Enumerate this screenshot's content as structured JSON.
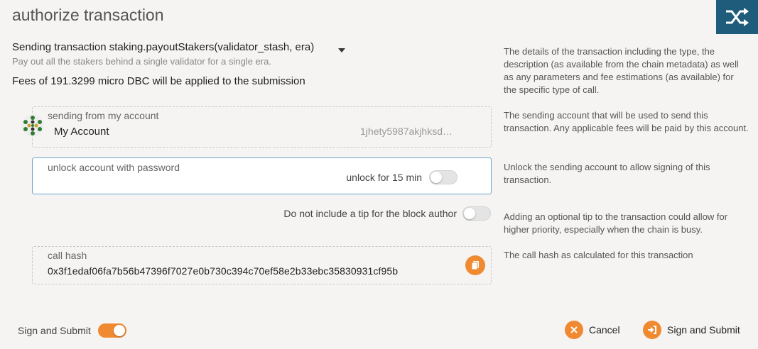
{
  "modal": {
    "title": "authorize transaction"
  },
  "transaction": {
    "line": "Sending transaction staking.payoutStakers(validator_stash, era)",
    "description": "Pay out all the stakers behind a single validator for a single era.",
    "fees": "Fees of 191.3299 micro DBC will be applied to the submission",
    "help": "The details of the transaction including the type, the description (as available from the chain metadata) as well as any parameters and fee estimations (as available) for the specific type of call."
  },
  "account": {
    "label": "sending from my account",
    "name": "My Account",
    "address": "1jhety5987akjhksd…",
    "help": "The sending account that will be used to send this transaction. Any applicable fees will be paid by this account."
  },
  "unlock": {
    "label": "unlock account with password",
    "toggle_label": "unlock for 15 min",
    "toggle_on": false,
    "help": "Unlock the sending account to allow signing of this transaction."
  },
  "tip": {
    "toggle_label": "Do not include a tip for the block author",
    "toggle_on": false,
    "help": "Adding an optional tip to the transaction could allow for higher priority, especially when the chain is busy."
  },
  "call_hash": {
    "label": "call hash",
    "value": "0x3f1edaf06fa7b56b47396f7027e0b730c394c70ef58e2b33ebc35830931cf95b",
    "help": "The call hash as calculated for this transaction"
  },
  "footer": {
    "sign_toggle_label": "Sign and Submit",
    "sign_toggle_on": true,
    "cancel_label": "Cancel",
    "submit_label": "Sign and Submit"
  },
  "colors": {
    "accent": "#f08a30",
    "corner": "#1f5c7c"
  }
}
